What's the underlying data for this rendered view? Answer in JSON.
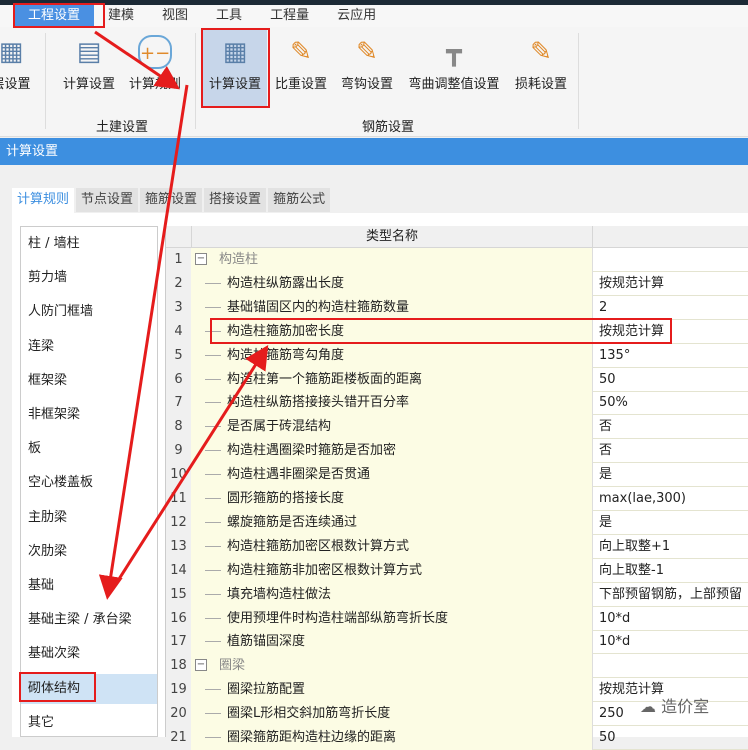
{
  "menu": [
    "工程设置",
    "建模",
    "视图",
    "工具",
    "工程量",
    "云应用"
  ],
  "ribbon": {
    "left_cut": "层设置",
    "groups": [
      {
        "label": "土建设置",
        "buttons": [
          "计算设置",
          "计算规则"
        ]
      },
      {
        "label": "钢筋设置",
        "buttons": [
          "计算设置",
          "比重设置",
          "弯钩设置",
          "弯曲调整值设置",
          "损耗设置"
        ]
      }
    ]
  },
  "window_title": "计算设置",
  "tabs": [
    "计算规则",
    "节点设置",
    "箍筋设置",
    "搭接设置",
    "箍筋公式"
  ],
  "left_list": [
    "柱 / 墙柱",
    "剪力墙",
    "人防门框墙",
    "连梁",
    "框架梁",
    "非框架梁",
    "板",
    "空心楼盖板",
    "主肋梁",
    "次肋梁",
    "基础",
    "基础主梁 / 承台梁",
    "基础次梁",
    "砌体结构",
    "其它"
  ],
  "selected_left": "砌体结构",
  "grid": {
    "header": "类型名称",
    "rows": [
      {
        "n": "1",
        "name": "构造柱",
        "value": "",
        "group": true
      },
      {
        "n": "2",
        "name": "构造柱纵筋露出长度",
        "value": "按规范计算"
      },
      {
        "n": "3",
        "name": "基础锚固区内的构造柱箍筋数量",
        "value": "2"
      },
      {
        "n": "4",
        "name": "构造柱箍筋加密长度",
        "value": "按规范计算"
      },
      {
        "n": "5",
        "name": "构造柱箍筋弯勾角度",
        "value": "135°"
      },
      {
        "n": "6",
        "name": "构造柱第一个箍筋距楼板面的距离",
        "value": "50"
      },
      {
        "n": "7",
        "name": "构造柱纵筋搭接接头错开百分率",
        "value": "50%"
      },
      {
        "n": "8",
        "name": "是否属于砖混结构",
        "value": "否"
      },
      {
        "n": "9",
        "name": "构造柱遇圈梁时箍筋是否加密",
        "value": "否"
      },
      {
        "n": "10",
        "name": "构造柱遇非圈梁是否贯通",
        "value": "是"
      },
      {
        "n": "11",
        "name": "圆形箍筋的搭接长度",
        "value": "max(lae,300)"
      },
      {
        "n": "12",
        "name": "螺旋箍筋是否连续通过",
        "value": "是"
      },
      {
        "n": "13",
        "name": "构造柱箍筋加密区根数计算方式",
        "value": "向上取整+1"
      },
      {
        "n": "14",
        "name": "构造柱箍筋非加密区根数计算方式",
        "value": "向上取整-1"
      },
      {
        "n": "15",
        "name": "填充墙构造柱做法",
        "value": "下部预留钢筋，上部预留"
      },
      {
        "n": "16",
        "name": "使用预埋件时构造柱端部纵筋弯折长度",
        "value": "10*d"
      },
      {
        "n": "17",
        "name": "植筋锚固深度",
        "value": "10*d"
      },
      {
        "n": "18",
        "name": "圈梁",
        "value": "",
        "group": true
      },
      {
        "n": "19",
        "name": "圈梁拉筋配置",
        "value": "按规范计算"
      },
      {
        "n": "20",
        "name": "圈梁L形相交斜加筋弯折长度",
        "value": "250"
      },
      {
        "n": "21",
        "name": "圈梁箍筋距构造柱边缘的距离",
        "value": "50"
      }
    ]
  },
  "watermark": "造价室",
  "colors": {
    "accent": "#3d8fe0",
    "annotation": "#e51c1c",
    "row_bg": "#fcfce4"
  }
}
